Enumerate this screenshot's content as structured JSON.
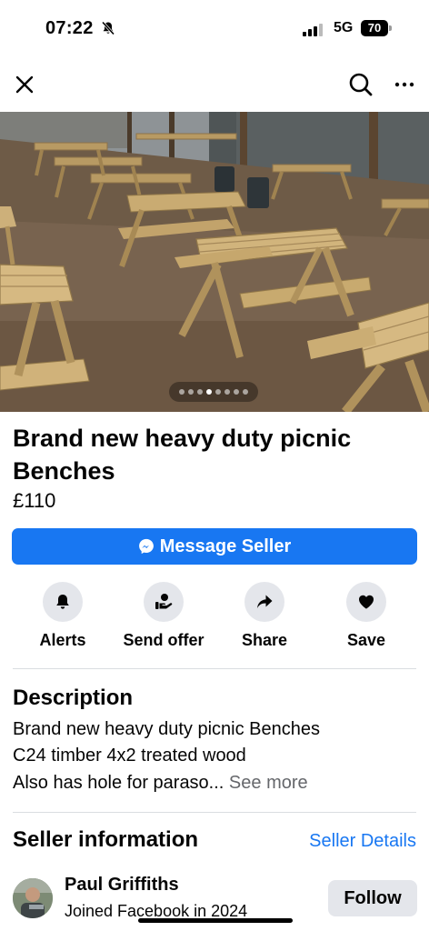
{
  "status_bar": {
    "time": "07:22",
    "network": "5G",
    "battery": "70"
  },
  "nav": {
    "close_icon": "close-icon",
    "search_icon": "search-icon",
    "more_icon": "more-icon"
  },
  "gallery": {
    "photo_count": 8,
    "active_index": 3
  },
  "listing": {
    "title": "Brand new heavy duty picnic Benches",
    "price": "£110",
    "message_button": "Message Seller"
  },
  "actions": [
    {
      "label": "Alerts",
      "icon": "bell-icon"
    },
    {
      "label": "Send offer",
      "icon": "offer-icon"
    },
    {
      "label": "Share",
      "icon": "share-icon"
    },
    {
      "label": "Save",
      "icon": "heart-icon"
    }
  ],
  "description": {
    "heading": "Description",
    "line1": "Brand new heavy duty picnic Benches",
    "line2": "C24 timber 4x2 treated wood",
    "line3": "Also has hole for paraso...",
    "see_more": "See more"
  },
  "seller": {
    "heading": "Seller information",
    "details_link": "Seller Details",
    "name": "Paul Griffiths",
    "joined": "Joined Facebook in 2024",
    "follow_button": "Follow"
  },
  "colors": {
    "accent": "#1877f2",
    "button_grey": "#e4e6eb"
  }
}
